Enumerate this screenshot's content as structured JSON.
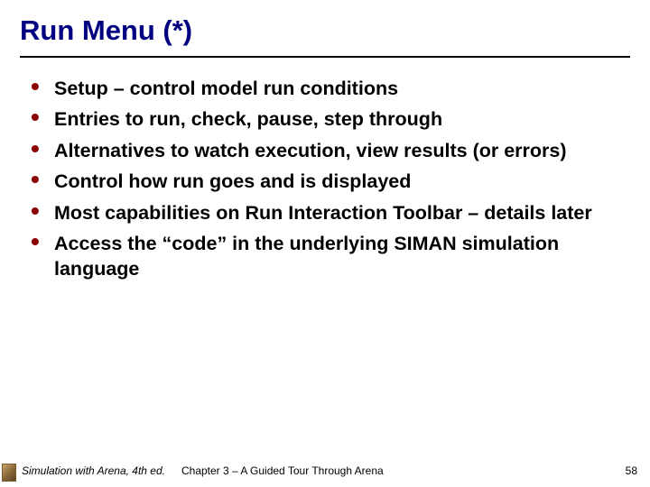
{
  "title": "Run Menu (*)",
  "bullets": [
    "Setup – control model run conditions",
    "Entries to run, check, pause, step through",
    "Alternatives to watch execution, view results (or errors)",
    "Control how run goes and is displayed",
    "Most capabilities on Run Interaction Toolbar – details later",
    "Access the “code” in the underlying SIMAN simulation language"
  ],
  "footer": {
    "left": "Simulation with Arena, 4th ed.",
    "center": "Chapter 3 – A Guided Tour Through Arena",
    "page": "58"
  }
}
